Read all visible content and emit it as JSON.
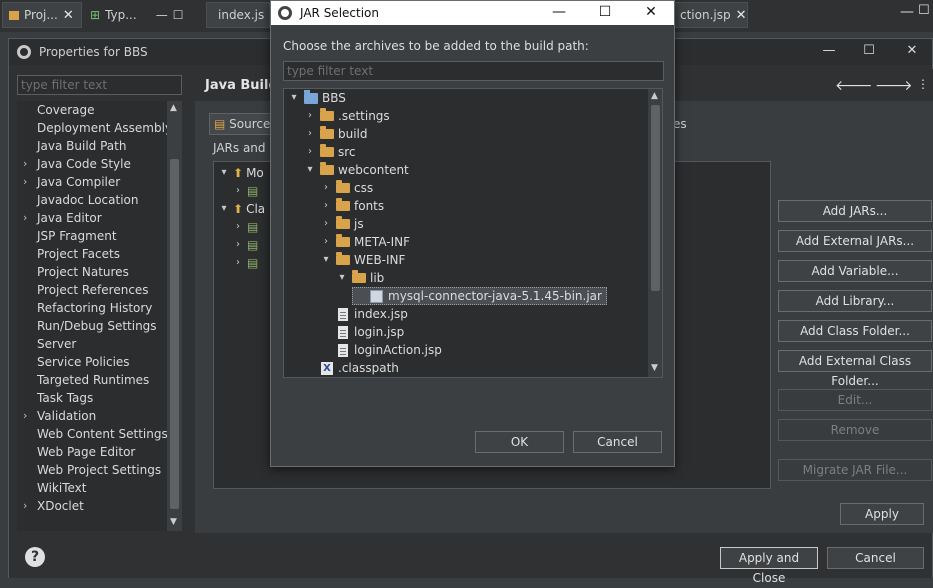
{
  "background_tabs": {
    "project_tab": "Proj...",
    "type_tab": "Typ...",
    "editor_tab_1": "index.js",
    "editor_tab_2": "ction.jsp"
  },
  "properties_dialog": {
    "title": "Properties for BBS",
    "filter_placeholder": "type filter text",
    "nav_items": [
      {
        "label": "Coverage",
        "expandable": false
      },
      {
        "label": "Deployment Assembly",
        "expandable": false
      },
      {
        "label": "Java Build Path",
        "expandable": false
      },
      {
        "label": "Java Code Style",
        "expandable": true
      },
      {
        "label": "Java Compiler",
        "expandable": true
      },
      {
        "label": "Javadoc Location",
        "expandable": false
      },
      {
        "label": "Java Editor",
        "expandable": true
      },
      {
        "label": "JSP Fragment",
        "expandable": false
      },
      {
        "label": "Project Facets",
        "expandable": false
      },
      {
        "label": "Project Natures",
        "expandable": false
      },
      {
        "label": "Project References",
        "expandable": false
      },
      {
        "label": "Refactoring History",
        "expandable": false
      },
      {
        "label": "Run/Debug Settings",
        "expandable": false
      },
      {
        "label": "Server",
        "expandable": false
      },
      {
        "label": "Service Policies",
        "expandable": false
      },
      {
        "label": "Targeted Runtimes",
        "expandable": false
      },
      {
        "label": "Task Tags",
        "expandable": false
      },
      {
        "label": "Validation",
        "expandable": true
      },
      {
        "label": "Web Content Settings",
        "expandable": false
      },
      {
        "label": "Web Page Editor",
        "expandable": false
      },
      {
        "label": "Web Project Settings",
        "expandable": false
      },
      {
        "label": "WikiText",
        "expandable": false
      },
      {
        "label": "XDoclet",
        "expandable": true
      }
    ],
    "page_title": "Java Build",
    "source_tab": "Source",
    "tab_suffix": "es",
    "jars_label": "JARs and c",
    "tree_partial": [
      "Mo",
      "Cla"
    ],
    "buttons": {
      "add_jars": "Add JARs...",
      "add_external_jars": "Add External JARs...",
      "add_variable": "Add Variable...",
      "add_library": "Add Library...",
      "add_class_folder": "Add Class Folder...",
      "add_external_class_folder": "Add External Class Folder...",
      "edit": "Edit...",
      "remove": "Remove",
      "migrate_jar": "Migrate JAR File...",
      "apply": "Apply",
      "apply_and_close": "Apply and Close",
      "cancel": "Cancel"
    }
  },
  "jar_dialog": {
    "title": "JAR Selection",
    "message": "Choose the archives to be added to the build path:",
    "filter_placeholder": "type filter text",
    "tree": [
      {
        "label": "BBS",
        "icon": "project",
        "depth": 0,
        "expanded": true
      },
      {
        "label": ".settings",
        "icon": "folder",
        "depth": 1,
        "expanded": false
      },
      {
        "label": "build",
        "icon": "folder",
        "depth": 1,
        "expanded": false
      },
      {
        "label": "src",
        "icon": "folder",
        "depth": 1,
        "expanded": false
      },
      {
        "label": "webcontent",
        "icon": "folder",
        "depth": 1,
        "expanded": true
      },
      {
        "label": "css",
        "icon": "folder",
        "depth": 2,
        "expanded": false
      },
      {
        "label": "fonts",
        "icon": "folder",
        "depth": 2,
        "expanded": false
      },
      {
        "label": "js",
        "icon": "folder",
        "depth": 2,
        "expanded": false
      },
      {
        "label": "META-INF",
        "icon": "folder",
        "depth": 2,
        "expanded": false
      },
      {
        "label": "WEB-INF",
        "icon": "folder",
        "depth": 2,
        "expanded": true
      },
      {
        "label": "lib",
        "icon": "folder",
        "depth": 3,
        "expanded": true
      },
      {
        "label": "mysql-connector-java-5.1.45-bin.jar",
        "icon": "jar",
        "depth": 4,
        "selected": true
      },
      {
        "label": "index.jsp",
        "icon": "file",
        "depth": 2
      },
      {
        "label": "login.jsp",
        "icon": "file",
        "depth": 2
      },
      {
        "label": "loginAction.jsp",
        "icon": "file",
        "depth": 2
      },
      {
        "label": ".classpath",
        "icon": "xfile",
        "depth": 1
      }
    ],
    "ok_label": "OK",
    "cancel_label": "Cancel"
  }
}
